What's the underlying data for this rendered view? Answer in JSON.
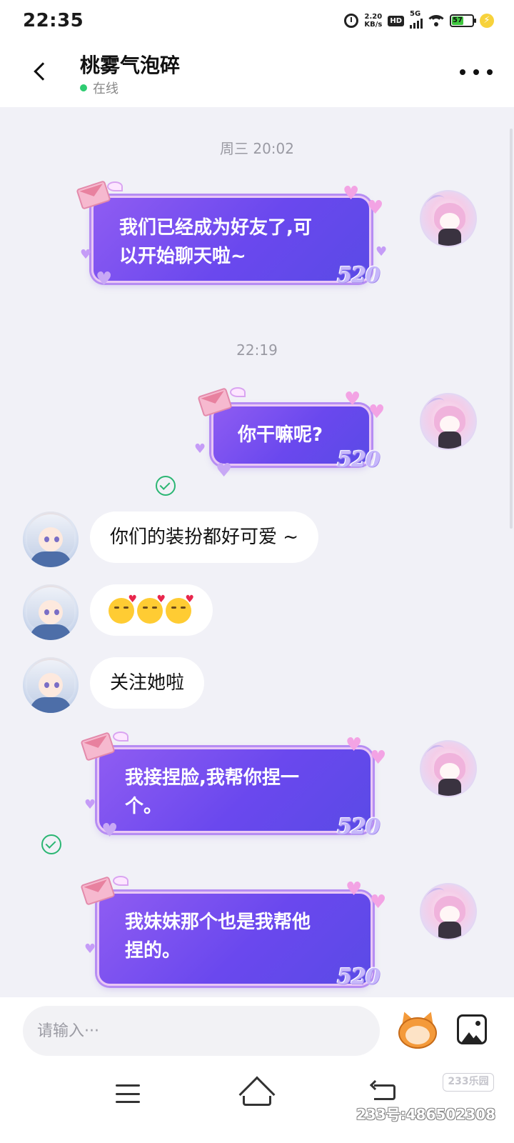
{
  "status_bar": {
    "time": "22:35",
    "net_speed_value": "2.20",
    "net_speed_unit": "KB/s",
    "hd": "HD",
    "signal": "5G",
    "battery": "57"
  },
  "header": {
    "contact_name": "桃雾气泡碎",
    "status": "在线"
  },
  "messages": [
    {
      "type": "timestamp",
      "text": "周三 20:02"
    },
    {
      "type": "sent",
      "text": "我们已经成为好友了,可以开始聊天啦~",
      "line1": "我们已经成为好友了,可",
      "line2": "以开始聊天啦~",
      "badge": "520"
    },
    {
      "type": "timestamp",
      "text": "22:19"
    },
    {
      "type": "sent",
      "text": "你干嘛呢?",
      "badge": "520",
      "read": true
    },
    {
      "type": "received",
      "text": "你们的装扮都好可爱 ~"
    },
    {
      "type": "received",
      "emoji": [
        "face-blowing-kiss",
        "face-blowing-kiss",
        "face-blowing-kiss"
      ]
    },
    {
      "type": "received",
      "text": "关注她啦"
    },
    {
      "type": "sent",
      "text": "我接捏脸,我帮你捏一个。",
      "line1": "我接捏脸,我帮你捏一",
      "line2": "个。",
      "badge": "520",
      "read": true
    },
    {
      "type": "sent",
      "text": "我妹妹那个也是我帮他捏的。",
      "line1": "我妹妹那个也是我帮他",
      "line2": "捏的。",
      "badge": "520"
    }
  ],
  "input": {
    "placeholder": "请输入···"
  },
  "watermark": {
    "logo": "233乐园",
    "id": "233号:486502308"
  },
  "colors": {
    "bubble_sent": "#6a48ee",
    "bubble_received": "#ffffff",
    "chat_bg": "#f1f1f7",
    "online": "#2ecc71",
    "read_check": "#2bb673"
  }
}
